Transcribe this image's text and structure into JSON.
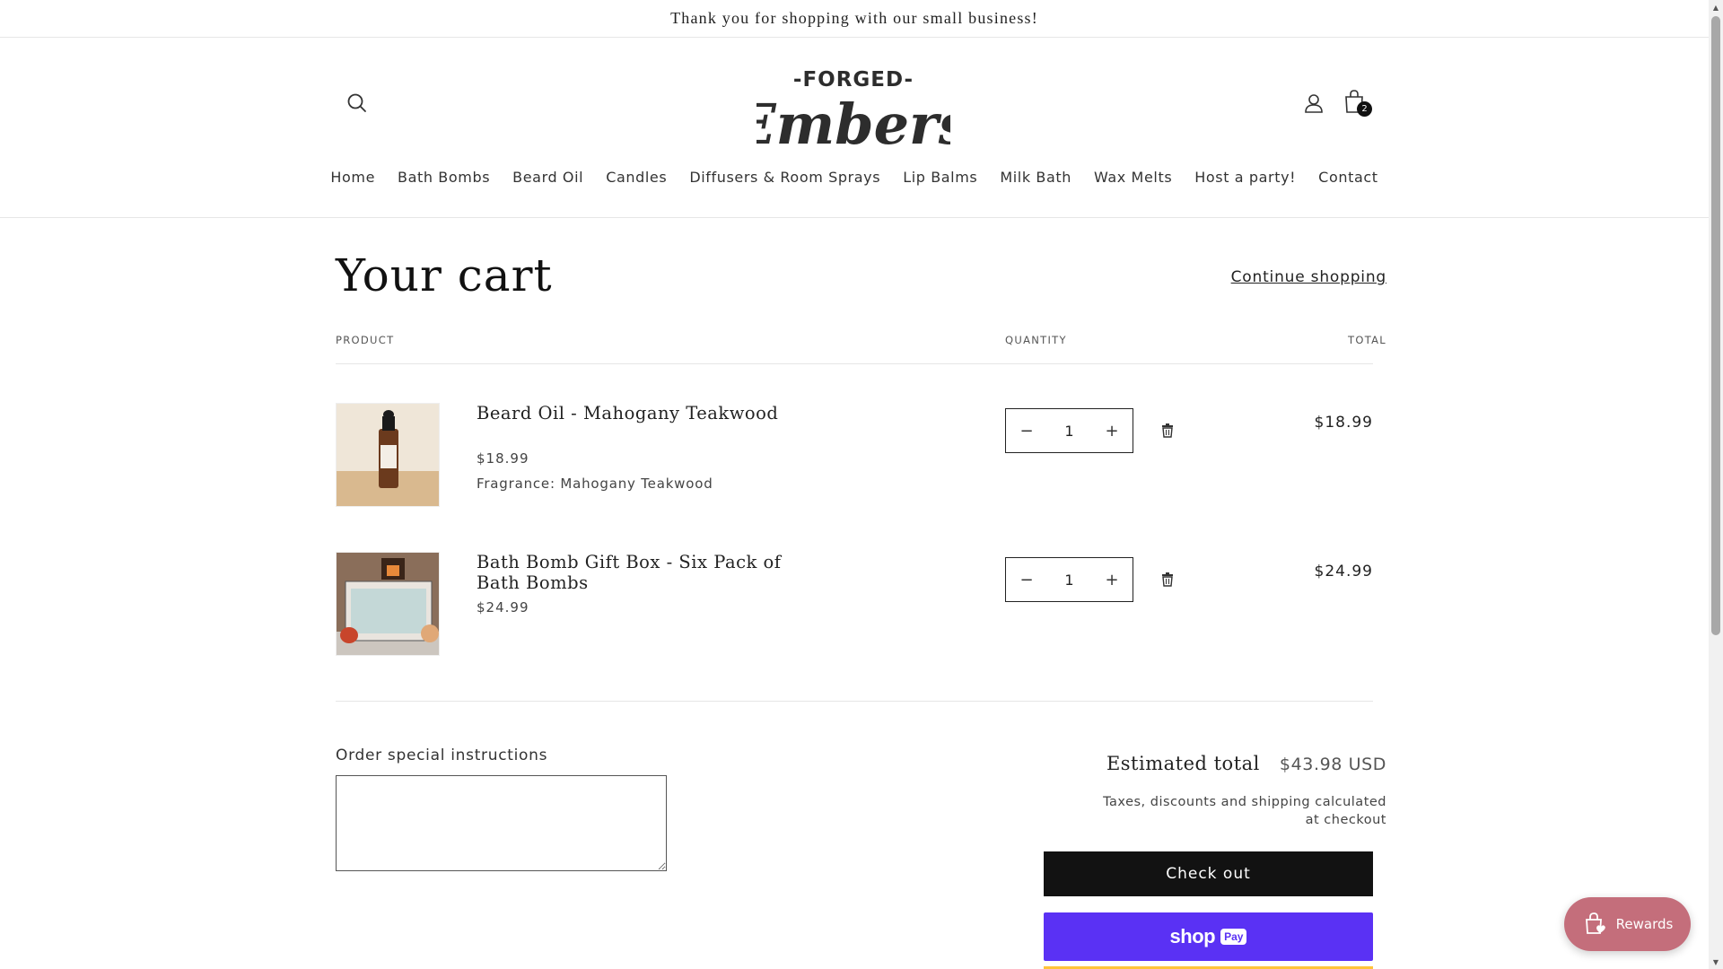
{
  "announcement": "Thank you for shopping with our small business!",
  "header": {
    "logo_top": "-FORGED-",
    "logo_main": "Embers",
    "cart_count": "2",
    "icons": {
      "search": "search-icon",
      "account": "user-icon",
      "cart": "shopping-bag-icon"
    }
  },
  "nav": [
    "Home",
    "Bath Bombs",
    "Beard Oil",
    "Candles",
    "Diffusers & Room Sprays",
    "Lip Balms",
    "Milk Bath",
    "Wax Melts",
    "Host a party!",
    "Contact"
  ],
  "cart": {
    "title": "Your cart",
    "continue": "Continue shopping",
    "columns": {
      "product": "PRODUCT",
      "quantity": "QUANTITY",
      "total": "TOTAL"
    },
    "items": [
      {
        "name": "Beard Oil - Mahogany Teakwood",
        "price": "$18.99",
        "variant": "Fragrance: Mahogany Teakwood",
        "qty": "1",
        "total": "$18.99",
        "image": "beard-oil-bottle"
      },
      {
        "name": "Bath Bomb Gift Box - Six Pack of Bath Bombs",
        "price": "$24.99",
        "qty": "1",
        "total": "$24.99",
        "image": "bath-bomb-gift-box"
      }
    ],
    "qty_minus": "−",
    "qty_plus": "+"
  },
  "footer": {
    "instructions_label": "Order special instructions",
    "instructions_value": "",
    "estimated_label": "Estimated total",
    "estimated_value": "$43.98 USD",
    "tax_note": "Taxes, discounts and shipping calculated at checkout",
    "checkout": "Check out",
    "shoppay_shop": "shop",
    "shoppay_pay": "Pay"
  },
  "rewards": "Rewards",
  "colors": {
    "shoppay": "#5a31f4",
    "checkout": "#121212",
    "rewards": "#c46e7b"
  }
}
